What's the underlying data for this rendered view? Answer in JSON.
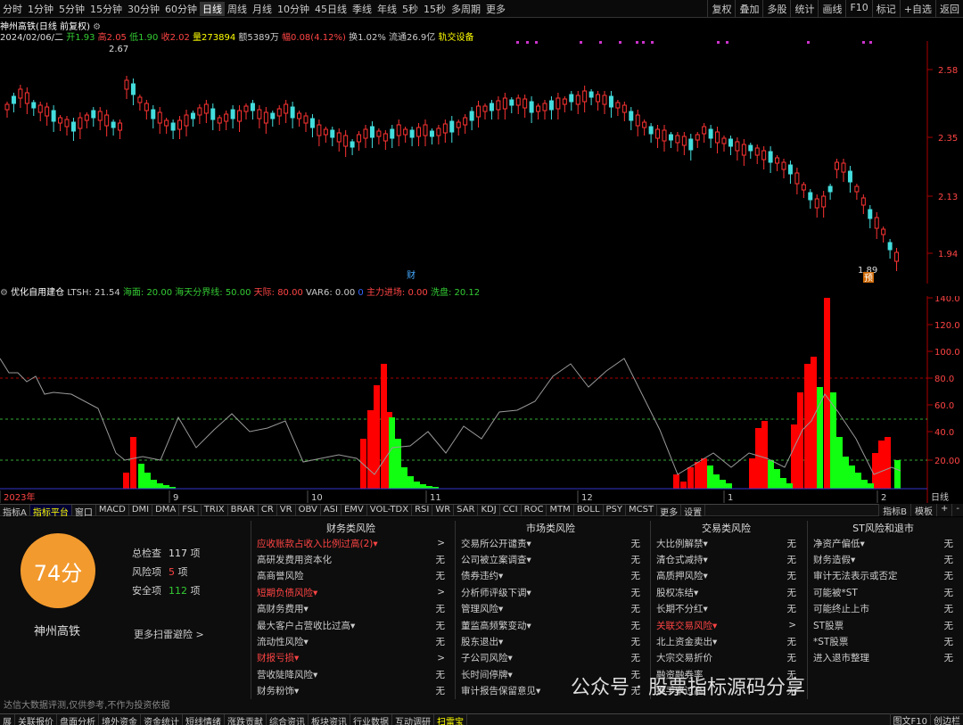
{
  "toolbar": {
    "timeframes": [
      "分时",
      "1分钟",
      "5分钟",
      "15分钟",
      "30分钟",
      "60分钟",
      "日线",
      "周线",
      "月线",
      "10分钟",
      "45日线",
      "季线",
      "年线",
      "5秒",
      "15秒",
      "多周期",
      "更多"
    ],
    "active": "日线",
    "right": [
      "复权",
      "叠加",
      "多股",
      "统计",
      "画线",
      "F10",
      "标记",
      "+自选",
      "返回"
    ]
  },
  "stock": {
    "title": "神州高铁(日线 前复权)",
    "date": "2024/02/06/二",
    "open_label": "开",
    "open": "1.93",
    "high_label": "高",
    "high": "2.05",
    "low_label": "低",
    "low": "1.90",
    "close_label": "收",
    "close": "2.02",
    "vol_label": "量",
    "vol": "273894",
    "amt_label": "额",
    "amt": "5389万",
    "chg_label": "幅",
    "chg": "0.08(4.12%)",
    "turn_label": "换",
    "turn": "1.02%",
    "flow_label": "流通",
    "flow": "26.9亿",
    "concept": "轨交设备"
  },
  "price_axis": [
    "2.58",
    "2.35",
    "2.13",
    "1.94"
  ],
  "markers": {
    "high": "2.67",
    "low": "1.89",
    "cai": "财",
    "yu": "预"
  },
  "indicator": {
    "name": "优化自用建仓",
    "ltsh": "LTSH: 21.54",
    "haimian": "海面: 20.00",
    "haitian": "海天分界线: 50.00",
    "tiankong": "天际: 80.00",
    "var6": "VAR6: 0.00",
    "dot": "0",
    "zhuli": "主力进场: 0.00",
    "xipan": "洗盘: 20.12"
  },
  "ind_axis": [
    "140.0",
    "120.0",
    "100.0",
    "80.0",
    "60.0",
    "40.0",
    "20.00"
  ],
  "x_axis": [
    "2023年",
    "9",
    "10",
    "11",
    "12",
    "1",
    "2"
  ],
  "x_right": "日线",
  "chart_data": {
    "type": "bar",
    "series": [
      {
        "name": "主力进场",
        "values": [
          0,
          0,
          0,
          0,
          0,
          0,
          0,
          0,
          0,
          0,
          0,
          0,
          0,
          0,
          0,
          0,
          0,
          0,
          0,
          0,
          0,
          0,
          0,
          0,
          0,
          0,
          0,
          0,
          0,
          0,
          0,
          0,
          0,
          0,
          0,
          0,
          0,
          0,
          0,
          0,
          0,
          0,
          0,
          0,
          0,
          0,
          0,
          0,
          0,
          0,
          0,
          0,
          0,
          0,
          0,
          0,
          0,
          0,
          0,
          0,
          0,
          0,
          0,
          0,
          0,
          0,
          0,
          0,
          0,
          0,
          0,
          0,
          0,
          0,
          0,
          0,
          0,
          0,
          0,
          0,
          0,
          0,
          0,
          0,
          0,
          0,
          0,
          0,
          0,
          0,
          0,
          0,
          0,
          0,
          0,
          0,
          0,
          0,
          0,
          0,
          0,
          0,
          0,
          0,
          0,
          0,
          0,
          0,
          0,
          0,
          0,
          0,
          0,
          0,
          0,
          0,
          0,
          0,
          0,
          0,
          0,
          0,
          0,
          0,
          0,
          0,
          0,
          0,
          0,
          0,
          0,
          0,
          0,
          0,
          0,
          0,
          0,
          0,
          0,
          0,
          0,
          0,
          0
        ]
      },
      {
        "name": "洗盘",
        "values": [
          20.12
        ]
      }
    ],
    "ylim": [
      0,
      140
    ]
  },
  "tabs": [
    "指标A",
    "指标平台",
    "窗口",
    "MACD",
    "DMI",
    "DMA",
    "FSL",
    "TRIX",
    "BRAR",
    "CR",
    "VR",
    "OBV",
    "ASI",
    "EMV",
    "VOL-TDX",
    "RSI",
    "WR",
    "SAR",
    "KDJ",
    "CCI",
    "ROC",
    "MTM",
    "BOLL",
    "PSY",
    "MCST",
    "更多",
    "设置"
  ],
  "tabs_active": "指标平台",
  "tabs_right": [
    "指标B",
    "模板",
    "+",
    "-"
  ],
  "risk": {
    "score": "74分",
    "stock": "神州高铁",
    "total_label": "总检查",
    "total": "117",
    "total_unit": "项",
    "risk_label": "风险项",
    "risk": "5",
    "risk_unit": "项",
    "safe_label": "安全项",
    "safe": "112",
    "safe_unit": "项",
    "more": "更多扫雷避险 >",
    "cols": [
      {
        "title": "财务类风险",
        "items": [
          [
            "应收账款占收入比例过高(2)▾",
            ">",
            1
          ],
          [
            "高研发费用资本化",
            "无",
            0
          ],
          [
            "高商誉风险",
            "无",
            0
          ],
          [
            "短期负债风险▾",
            ">",
            1
          ],
          [
            "高财务费用▾",
            "无",
            0
          ],
          [
            "最大客户占营收比过高▾",
            "无",
            0
          ],
          [
            "流动性风险▾",
            "无",
            0
          ],
          [
            "财报亏损▾",
            ">",
            1
          ],
          [
            "营收陡降风险▾",
            "无",
            0
          ],
          [
            "财务粉饰▾",
            "无",
            0
          ]
        ]
      },
      {
        "title": "市场类风险",
        "items": [
          [
            "交易所公开谴责▾",
            "无",
            0
          ],
          [
            "公司被立案调查▾",
            "无",
            0
          ],
          [
            "债券违约▾",
            "无",
            0
          ],
          [
            "分析师评级下调▾",
            "无",
            0
          ],
          [
            "管理风险▾",
            "无",
            0
          ],
          [
            "董监高频繁变动▾",
            "无",
            0
          ],
          [
            "股东退出▾",
            "无",
            0
          ],
          [
            "子公司风险▾",
            "无",
            0
          ],
          [
            "长时间停牌▾",
            "无",
            0
          ],
          [
            "审计报告保留意见▾",
            "无",
            0
          ]
        ]
      },
      {
        "title": "交易类风险",
        "items": [
          [
            "大比例解禁▾",
            "无",
            0
          ],
          [
            "清仓式减持▾",
            "无",
            0
          ],
          [
            "高质押风险▾",
            "无",
            0
          ],
          [
            "股权冻结▾",
            "无",
            0
          ],
          [
            "长期不分红▾",
            "无",
            0
          ],
          [
            "关联交易风险▾",
            ">",
            1
          ],
          [
            "北上资金卖出▾",
            "无",
            0
          ],
          [
            "大宗交易折价",
            "无",
            0
          ],
          [
            "融资融券率",
            "无",
            0
          ],
          [
            "换手率过高",
            "无",
            0
          ]
        ]
      },
      {
        "title": "ST风险和退市",
        "items": [
          [
            "净资产偏低▾",
            "无",
            0
          ],
          [
            "财务造假▾",
            "无",
            0
          ],
          [
            "审计无法表示或否定",
            "无",
            0
          ],
          [
            "可能被*ST",
            "无",
            0
          ],
          [
            "可能终止上市",
            "无",
            0
          ],
          [
            "ST股票",
            "无",
            0
          ],
          [
            "*ST股票",
            "无",
            0
          ],
          [
            "进入退市整理",
            "无",
            0
          ]
        ]
      }
    ],
    "disclaimer": "达信大数据评测,仅供参考,不作为投资依据",
    "watermark": "公众号 · 股票指标源码分享"
  },
  "bottom": [
    "展",
    "关联报价",
    "盘面分析",
    "境外资金",
    "资金统计",
    "短线情绪",
    "涨跌贡献",
    "综合资讯",
    "板块资讯",
    "行业数据",
    "互动调研",
    "扫雷宝"
  ],
  "bottom_active": "扫雷宝",
  "bottom_right": [
    "图文F10",
    "创边栏"
  ]
}
